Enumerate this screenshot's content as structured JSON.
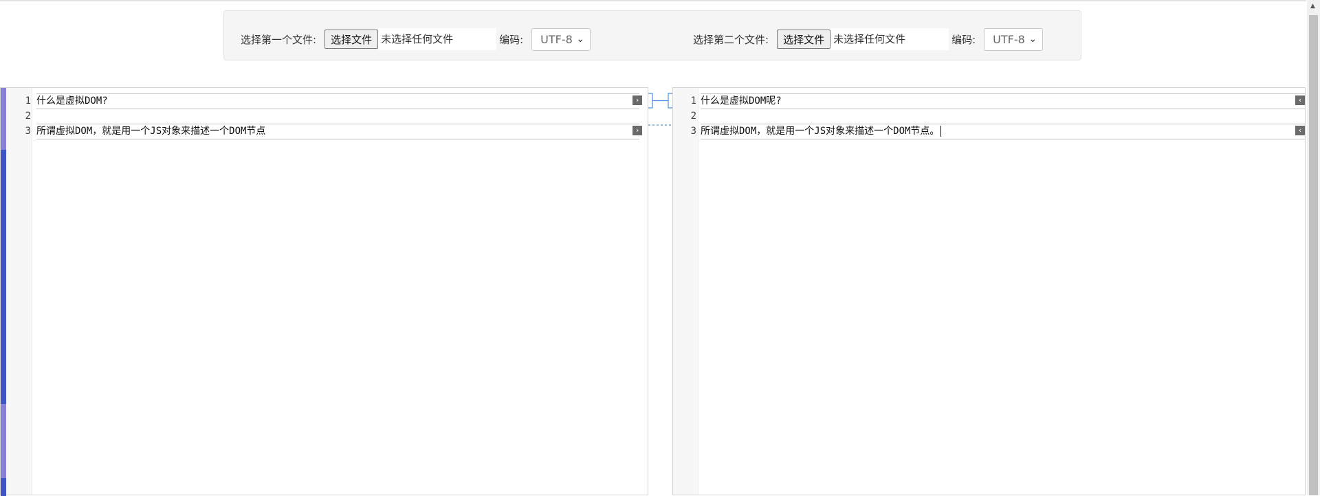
{
  "toolbar": {
    "left": {
      "label": "选择第一个文件:",
      "button": "选择文件",
      "file_status": "未选择任何文件",
      "encoding_label": "编码:",
      "encoding_value": "UTF-8"
    },
    "right": {
      "label": "选择第二个文件:",
      "button": "选择文件",
      "file_status": "未选择任何文件",
      "encoding_label": "编码:",
      "encoding_value": "UTF-8"
    }
  },
  "left_editor": {
    "lines": [
      {
        "num": "1",
        "text": "什么是虚拟DOM?"
      },
      {
        "num": "2",
        "text": ""
      },
      {
        "num": "3",
        "text": "所谓虚拟DOM，就是用一个JS对象来描述一个DOM节点"
      }
    ]
  },
  "right_editor": {
    "lines": [
      {
        "num": "1",
        "text": "什么是虚拟DOM呢?"
      },
      {
        "num": "2",
        "text": ""
      },
      {
        "num": "3",
        "text": "所谓虚拟DOM，就是用一个JS对象来描述一个DOM节点。"
      }
    ]
  },
  "icons": {
    "merge_right": "merge-right-icon",
    "merge_left": "merge-left-icon",
    "select_chevron": "chevron-down-icon"
  },
  "colors": {
    "change_marker": "#3f55c4",
    "connector": "#4a90e2"
  }
}
